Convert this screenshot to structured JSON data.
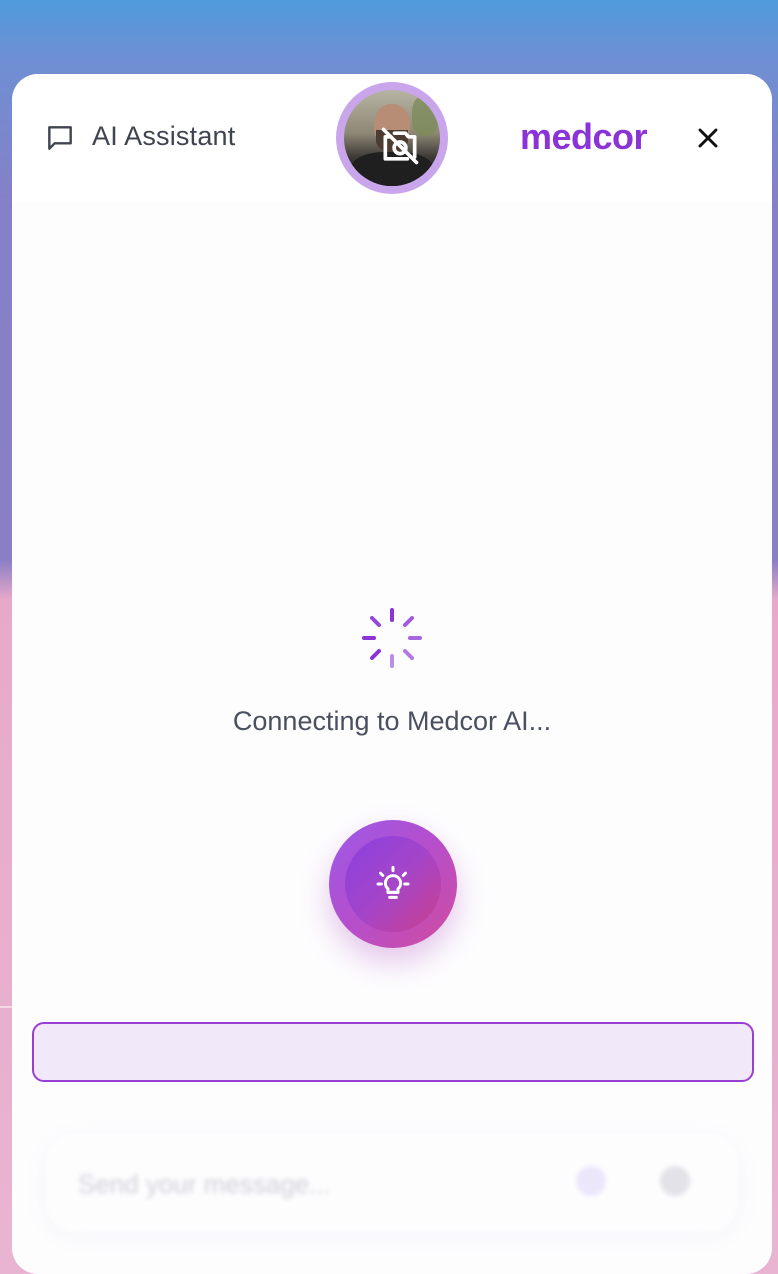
{
  "header": {
    "title": "AI Assistant",
    "brand": "medcor",
    "icons": {
      "chat": "message-square-icon",
      "camera": "camera-off-icon",
      "close": "close-icon"
    }
  },
  "status": {
    "text": "Connecting to Medcor AI..."
  },
  "orb": {
    "icon": "lightbulb-icon"
  },
  "transcript": {
    "value": ""
  },
  "composer": {
    "placeholder": "Send your message...",
    "icons": {
      "mic": "microphone-icon",
      "send": "send-icon"
    }
  },
  "colors": {
    "brand": "#8a34d8",
    "accent_border": "#9a3fd6",
    "transcript_bg": "#f1e8fa",
    "avatar_ring": "#c9a6ec",
    "orb_gradient_start": "#9b5ae8",
    "orb_gradient_end": "#d14c9e"
  }
}
